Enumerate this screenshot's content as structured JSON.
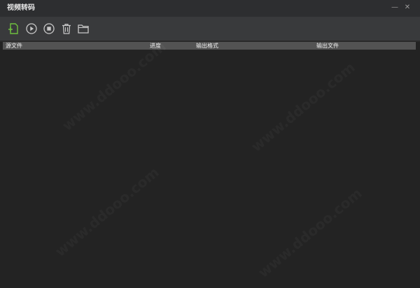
{
  "window": {
    "title": "视频转码",
    "minimize_glyph": "—",
    "close_glyph": "✕"
  },
  "toolbar": {
    "buttons": [
      {
        "icon": "add-file-icon",
        "accent": "#6fbf3f"
      },
      {
        "icon": "play-icon"
      },
      {
        "icon": "stop-icon"
      },
      {
        "icon": "trash-icon"
      },
      {
        "icon": "folder-icon"
      }
    ]
  },
  "table": {
    "columns": [
      "源文件",
      "进度",
      "输出格式",
      "输出文件"
    ],
    "rows": []
  },
  "watermark": "www.ddooo.com",
  "colors": {
    "background": "#232323",
    "toolbar": "#393a3c",
    "header": "#535353",
    "accent": "#6fbf3f",
    "icon": "#c8c8c8"
  }
}
